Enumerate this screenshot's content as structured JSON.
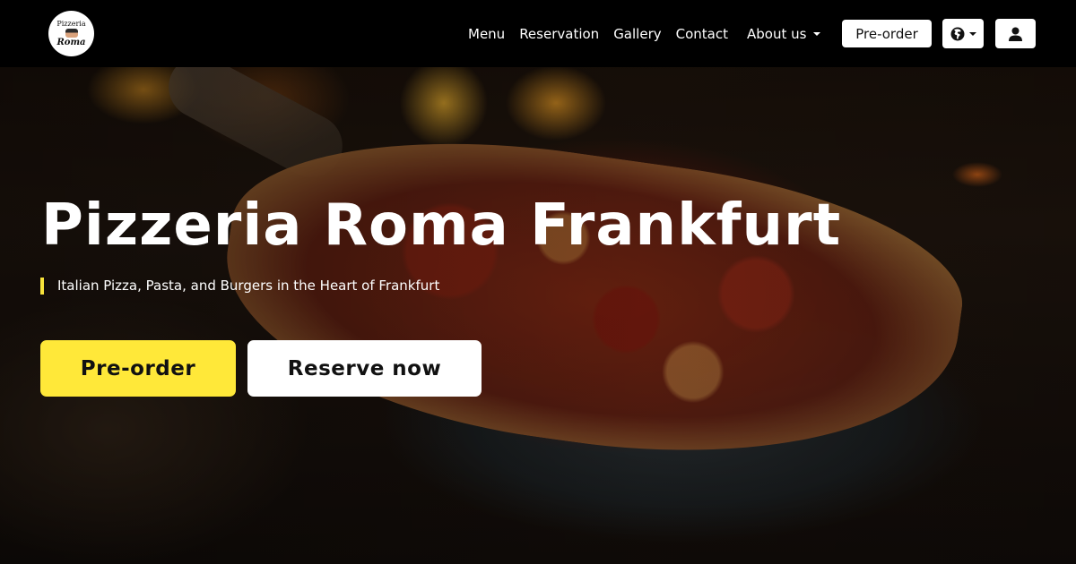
{
  "brand": {
    "logo_top": "Pizzeria",
    "logo_bottom": "Roma"
  },
  "nav": {
    "links": [
      "Menu",
      "Reservation",
      "Gallery",
      "Contact",
      "About us"
    ],
    "preorder_label": "Pre-order",
    "language_icon": "globe-icon",
    "user_icon": "user-icon"
  },
  "hero": {
    "title": "Pizzeria Roma Frankfurt",
    "subtitle": "Italian Pizza, Pasta, and Burgers in the Heart of Frankfurt",
    "primary_button": "Pre-order",
    "secondary_button": "Reserve now"
  },
  "colors": {
    "navbar_bg": "#000000",
    "accent_yellow": "#ffe839",
    "subtitle_bar": "#f7e23a",
    "button_white": "#ffffff"
  }
}
